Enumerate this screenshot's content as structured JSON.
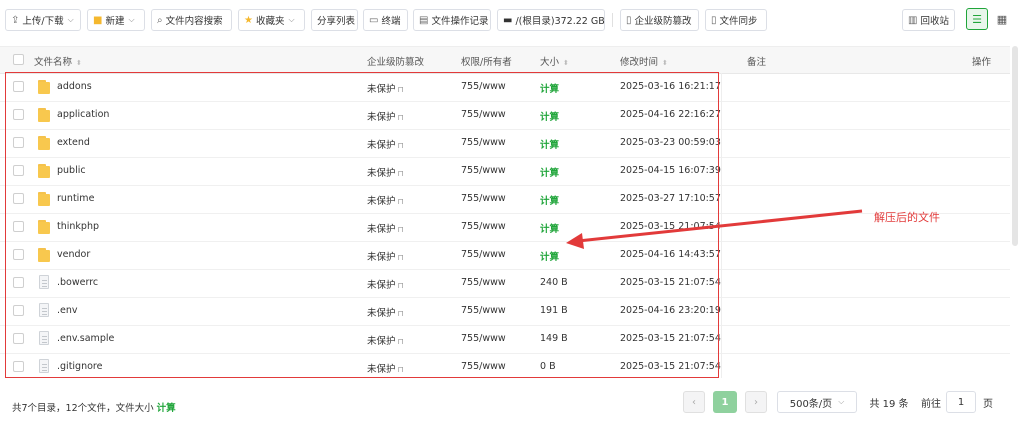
{
  "toolbar": {
    "upload_download": "上传/下载",
    "new": "新建",
    "search_content": "文件内容搜索",
    "favorites": "收藏夹",
    "share_list": "分享列表",
    "terminal": "终端",
    "file_log": "文件操作记录",
    "disk": "/(根目录)372.22 GB",
    "tamper_protect": "企业级防篡改",
    "file_sync": "文件同步",
    "recycle_bin": "回收站"
  },
  "table": {
    "headers": {
      "name": "文件名称",
      "protect": "企业级防篡改",
      "perm": "权限/所有者",
      "size": "大小",
      "mtime": "修改时间",
      "note": "备注",
      "ops": "操作"
    },
    "rows": [
      {
        "name": "addons",
        "type": "folder",
        "protect": "未保护",
        "perm": "755/www",
        "size": "计算",
        "mtime": "2025-03-16 16:21:17"
      },
      {
        "name": "application",
        "type": "folder",
        "protect": "未保护",
        "perm": "755/www",
        "size": "计算",
        "mtime": "2025-04-16 22:16:27"
      },
      {
        "name": "extend",
        "type": "folder",
        "protect": "未保护",
        "perm": "755/www",
        "size": "计算",
        "mtime": "2025-03-23 00:59:03"
      },
      {
        "name": "public",
        "type": "folder",
        "protect": "未保护",
        "perm": "755/www",
        "size": "计算",
        "mtime": "2025-04-15 16:07:39"
      },
      {
        "name": "runtime",
        "type": "folder",
        "protect": "未保护",
        "perm": "755/www",
        "size": "计算",
        "mtime": "2025-03-27 17:10:57"
      },
      {
        "name": "thinkphp",
        "type": "folder",
        "protect": "未保护",
        "perm": "755/www",
        "size": "计算",
        "mtime": "2025-03-15 21:07:54"
      },
      {
        "name": "vendor",
        "type": "folder",
        "protect": "未保护",
        "perm": "755/www",
        "size": "计算",
        "mtime": "2025-04-16 14:43:57"
      },
      {
        "name": ".bowerrc",
        "type": "file",
        "protect": "未保护",
        "perm": "755/www",
        "size": "240 B",
        "mtime": "2025-03-15 21:07:54"
      },
      {
        "name": ".env",
        "type": "file",
        "protect": "未保护",
        "perm": "755/www",
        "size": "191 B",
        "mtime": "2025-04-16 23:20:19"
      },
      {
        "name": ".env.sample",
        "type": "file",
        "protect": "未保护",
        "perm": "755/www",
        "size": "149 B",
        "mtime": "2025-03-15 21:07:54"
      },
      {
        "name": ".gitignore",
        "type": "file",
        "protect": "未保护",
        "perm": "755/www",
        "size": "0 B",
        "mtime": "2025-03-15 21:07:54"
      }
    ]
  },
  "annotation": {
    "text": "解压后的文件",
    "color": "#e23a3a"
  },
  "footer": {
    "summary": "共7个目录，12个文件，文件大小",
    "calc": "计算",
    "current_page": "1",
    "per_page": "500条/页",
    "total": "共 19 条",
    "goto_prefix": "前往",
    "goto_value": "1",
    "goto_suffix": "页"
  },
  "colors": {
    "accent": "#20a53a",
    "highlight": "#e23a3a"
  }
}
